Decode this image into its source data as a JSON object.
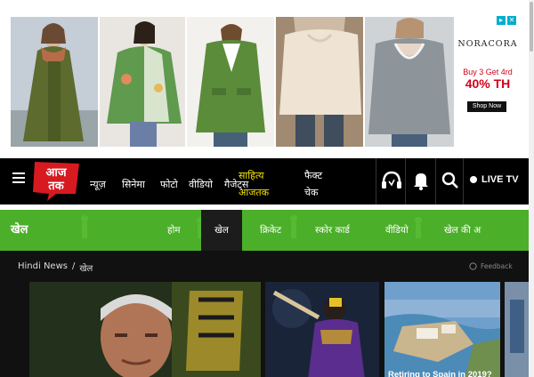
{
  "ad": {
    "brand": "NORACORA",
    "offer_line": "Buy 3 Get 4rd",
    "offer_big": "40% TH",
    "shop_label": "Shop Now",
    "products": [
      "olive-hooded-coat",
      "green-floral-shirt",
      "green-knit-cardigan",
      "beige-sweater",
      "grey-lace-sweater"
    ]
  },
  "header": {
    "logo_text": "आज तक",
    "nav": [
      "न्यूज़",
      "सिनेमा",
      "फोटो",
      "वीडियो",
      "गैजेट्स"
    ],
    "sahitya_line1": "साहित्य",
    "sahitya_line2": "आजतक",
    "factcheck_line1": "फैक्ट",
    "factcheck_line2": "चेक",
    "live_label": "LIVE TV",
    "icons": [
      "headphones-icon",
      "bell-icon",
      "search-icon"
    ]
  },
  "sports": {
    "title": "खेल",
    "tabs": [
      "होम",
      "खेल",
      "क्रिकेट",
      "स्कोर कार्ड",
      "वीडियो",
      "खेल की अ"
    ],
    "active_tab": "खेल"
  },
  "breadcrumb": {
    "home": "Hindi News",
    "separator": "/",
    "current": "खेल"
  },
  "feedback_label": "Feedback",
  "cards": [
    {
      "caption": ""
    },
    {
      "caption": ""
    },
    {
      "caption": "Retiring to Spain in 2019?"
    }
  ],
  "colors": {
    "accent_red": "#d71920",
    "sports_green": "#4caf2a",
    "sahitya_yellow": "#f4e300"
  }
}
